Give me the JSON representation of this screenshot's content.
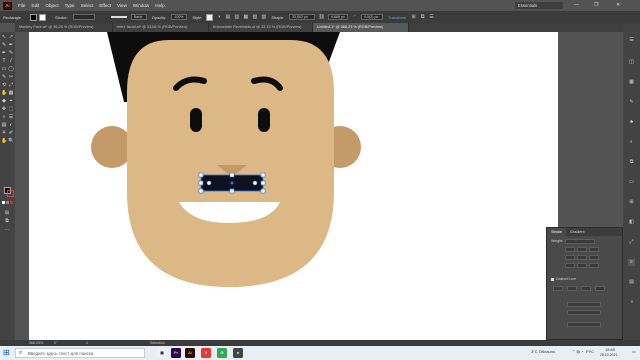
{
  "app": {
    "logo": "Ai",
    "brand_color": "#ff9a00"
  },
  "menu": {
    "items": [
      "File",
      "Edit",
      "Object",
      "Type",
      "Select",
      "Effect",
      "View",
      "Window",
      "Help"
    ],
    "workspace": "Essentials",
    "window_controls": [
      "—",
      "❐",
      "✕"
    ]
  },
  "control_bar": {
    "selection_label": "Rectangle",
    "stroke_label": "Stroke:",
    "stroke_weight": "",
    "stroke_style": "Basic",
    "opacity_label": "Opacity:",
    "opacity_value": "100%",
    "style_label": "Style:",
    "shape_label": "Shape:",
    "shape_width": "33,502 px",
    "shape_height": "6,889 px",
    "angle": "0,0(2) px",
    "transform_label": "Transform"
  },
  "tabs": [
    {
      "label": "Monkey Face.ai* @ 36,25 % (RGB/Preview)",
      "active": false
    },
    {
      "label": "tree1 facial.ai* @ 33,08 % (RGB/Preview)",
      "active": false
    },
    {
      "label": "Bobmeister Rezerialds.ai @ 33,13 % (RGB/Preview)",
      "active": false
    },
    {
      "label": "Untitled-1* @ 368,29 % (RGB/Preview)",
      "active": true
    }
  ],
  "tools": [
    "↖",
    "↗",
    "✎",
    "✒",
    "T",
    "/",
    "▭",
    "◯",
    "✂",
    "⟲",
    "⤢",
    "✋",
    "▦",
    "◆",
    "⌖",
    "✥",
    "⬚",
    "⌕",
    "☰",
    "▤",
    "◐",
    "⚘",
    "✐",
    "⬡",
    "⊞",
    "⧉",
    "✋",
    "🔍"
  ],
  "face": {
    "skin_color": "#dcb886",
    "ear_color": "#c49a68",
    "hair_color": "#0d0d0d",
    "eye_color": "#0d0d0d",
    "mouth_color": "#ffffff",
    "nose_color": "#c49a68",
    "mustache_color": "#0d1220",
    "selection_color": "#2d7ad6"
  },
  "stroke_panel": {
    "tabs": [
      "Stroke",
      "Gradient"
    ],
    "weight_label": "Weight:",
    "dashed_label": "Dashed Line"
  },
  "status_bar": {
    "zoom": "368,29%",
    "angle": "0°",
    "page": "1",
    "tool": "Selection"
  },
  "taskbar": {
    "search_placeholder": "Введите здесь текст для поиска",
    "apps": [
      {
        "label": "Pr",
        "color": "#2a0a4a",
        "text_color": "#d7a7ff"
      },
      {
        "label": "Ai",
        "color": "#2f0b06",
        "text_color": "#ff9a00"
      },
      {
        "label": "Y",
        "color": "#e53935",
        "text_color": "#ffffff"
      },
      {
        "label": "G",
        "color": "#34a853",
        "text_color": "#ffffff"
      },
      {
        "label": "●",
        "color": "#444444",
        "text_color": "#ffffff"
      }
    ],
    "weather": "3°C Облачно",
    "time": "15:55",
    "date": "28.10.2021",
    "lang": "РУС"
  }
}
